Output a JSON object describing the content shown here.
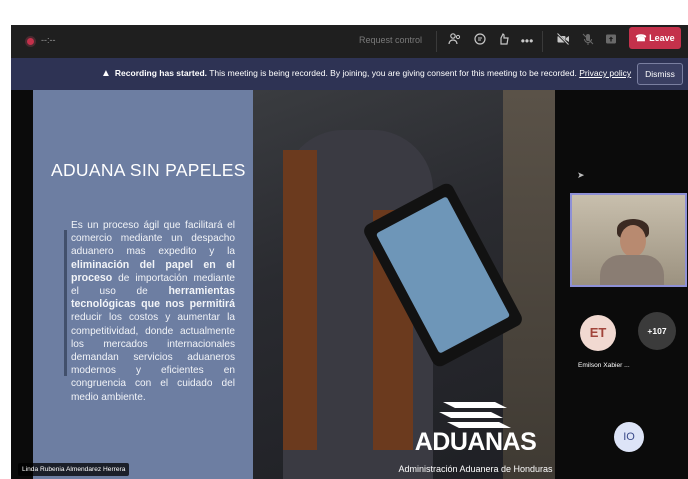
{
  "topbar": {
    "timer": "--:--",
    "request_control": "Request control",
    "leave_label": "Leave"
  },
  "banner": {
    "bold_text": "Recording has started.",
    "text": " This meeting is being recorded. By joining, you are giving consent for this meeting to be recorded.",
    "link_text": "Privacy policy",
    "dismiss_label": "Dismiss"
  },
  "slide": {
    "title": "ADUANA SIN PAPELES",
    "body_1": "Es un proceso ágil que facilitará el comercio mediante un despacho aduanero mas expedito y la ",
    "body_bold_1": "eliminación del papel en el proceso",
    "body_2": " de importación mediante el uso de ",
    "body_bold_2": "herramientas tecnológicas que nos permitirá",
    "body_3": " reducir los costos y aumentar la competitividad, donde actualmente los mercados internacionales demandan servicios aduaneros modernos y eficientes en congruencia con el cuidado del medio ambiente.",
    "logo_name": "ADUANAS",
    "logo_subtitle": "Administración Aduanera de Honduras"
  },
  "presenter": {
    "name": "Linda Rubenia Almendarez Herrera"
  },
  "participants": {
    "avatar_et_initials": "ET",
    "avatar_et_name": "Emilson Xabier ...",
    "more_count": "+107",
    "avatar_io_initials": "IO"
  },
  "colors": {
    "leave": "#c4314b",
    "banner": "#2e3354",
    "slide_panel": "#6d7ea2",
    "active_speaker_border": "#8e90d6"
  },
  "icons": [
    "record-icon",
    "people-icon",
    "chat-icon",
    "reactions-icon",
    "more-icon",
    "camera-off-icon",
    "mic-off-icon",
    "share-icon",
    "phone-icon",
    "warning-icon",
    "cursor-icon"
  ]
}
